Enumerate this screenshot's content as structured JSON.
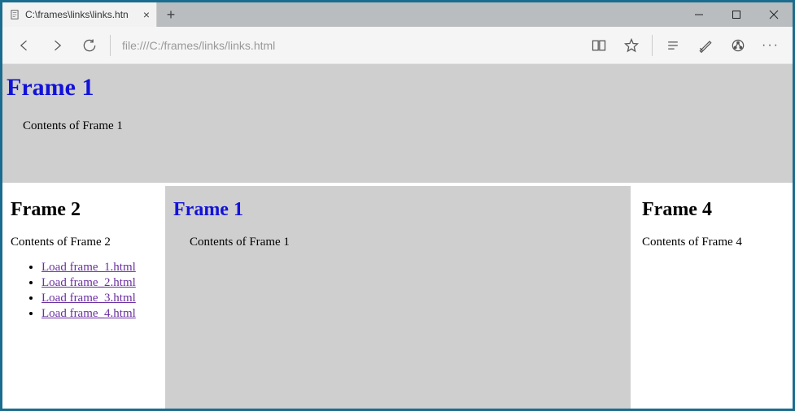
{
  "window": {
    "tab_title": "C:\\frames\\links\\links.htn",
    "url": "file:///C:/frames/links/links.html"
  },
  "frames": {
    "top": {
      "heading": "Frame 1",
      "body": "Contents of Frame 1"
    },
    "left": {
      "heading": "Frame 2",
      "body": "Contents of Frame 2",
      "links": [
        "Load frame_1.html",
        "Load frame_2.html",
        "Load frame_3.html",
        "Load frame_4.html"
      ]
    },
    "middle": {
      "heading": "Frame 1",
      "body": "Contents of Frame 1"
    },
    "right": {
      "heading": "Frame 4",
      "body": "Contents of Frame 4"
    }
  }
}
